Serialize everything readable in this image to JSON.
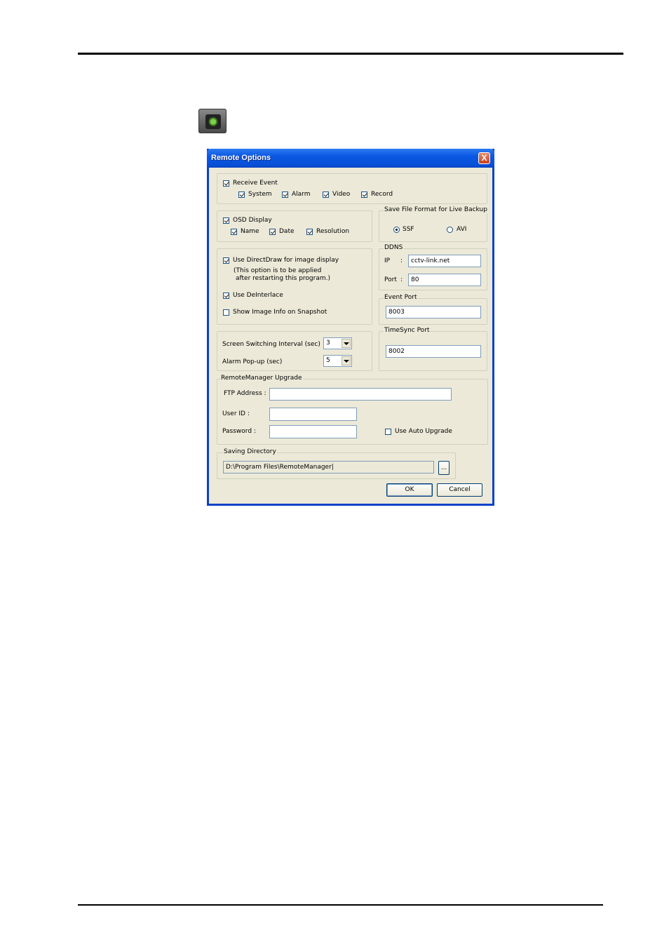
{
  "dialog": {
    "title": "Remote Options",
    "close_label": "X",
    "receive_event": {
      "label": "Receive Event",
      "checked": true,
      "options": [
        {
          "label": "System",
          "checked": true
        },
        {
          "label": "Alarm",
          "checked": true
        },
        {
          "label": "Video",
          "checked": true
        },
        {
          "label": "Record",
          "checked": true
        }
      ]
    },
    "osd": {
      "label": "OSD Display",
      "checked": true,
      "options": [
        {
          "label": "Name",
          "checked": true
        },
        {
          "label": "Date",
          "checked": true
        },
        {
          "label": "Resolution",
          "checked": true
        }
      ]
    },
    "save_format": {
      "legend": "Save File Format for Live Backup",
      "options": [
        {
          "label": "SSF",
          "selected": true
        },
        {
          "label": "AVI",
          "selected": false
        }
      ]
    },
    "display": {
      "directdraw_label": "Use DirectDraw for image display",
      "directdraw_checked": true,
      "note_line1": "(This option is to be applied",
      "note_line2": "after restarting this program.)",
      "deinterlace_label": "Use DeInterlace",
      "deinterlace_checked": true,
      "snapshot_label": "Show Image Info on Snapshot",
      "snapshot_checked": false
    },
    "ddns": {
      "legend": "DDNS",
      "ip_label": "IP",
      "ip_colon": ":",
      "ip_value": "cctv-link.net",
      "port_label": "Port",
      "port_colon": ":",
      "port_value": "80"
    },
    "event_port": {
      "legend": "Event Port",
      "value": "8003"
    },
    "timing": {
      "switching_label": "Screen Switching Interval (sec)",
      "switching_value": "3",
      "alarm_label": "Alarm Pop-up (sec)",
      "alarm_value": "5"
    },
    "timesync_port": {
      "legend": "TimeSync Port",
      "value": "8002"
    },
    "upgrade": {
      "legend": "RemoteManager Upgrade",
      "ftp_label": "FTP Address :",
      "ftp_value": "",
      "user_label": "User ID :",
      "user_value": "",
      "password_label": "Password :",
      "password_value": "",
      "auto_label": "Use Auto Upgrade",
      "auto_checked": false
    },
    "saving": {
      "legend": "Saving Directory",
      "path": "D:\\Program Files\\RemoteManager|",
      "browse_label": "..."
    },
    "ok_label": "OK",
    "cancel_label": "Cancel"
  },
  "icons": {
    "app": "camera-settings-icon"
  }
}
